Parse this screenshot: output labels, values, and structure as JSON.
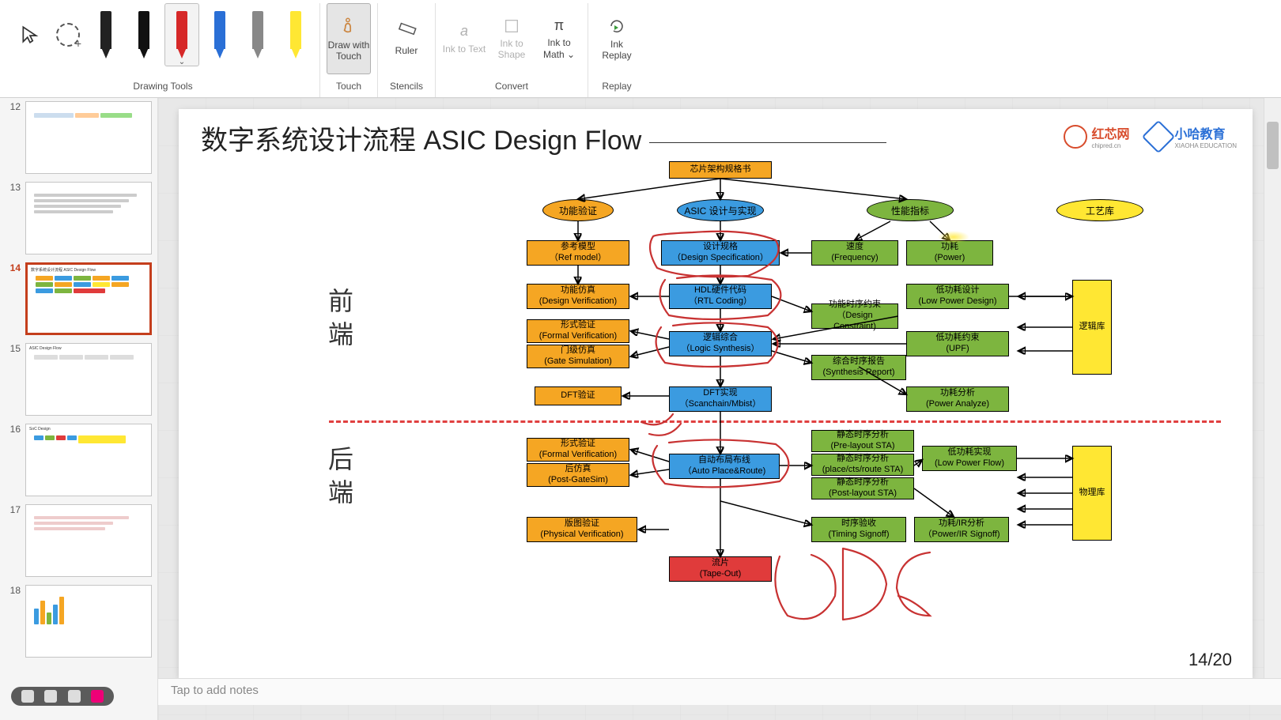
{
  "ribbon": {
    "groups": {
      "drawing": "Drawing Tools",
      "touch": "Touch",
      "stencils": "Stencils",
      "convert": "Convert",
      "replay": "Replay"
    },
    "tools": {
      "draw_touch": "Draw with Touch",
      "ruler": "Ruler",
      "ink_text": "Ink to Text",
      "ink_shape": "Ink to Shape",
      "ink_math": "Ink to Math ⌄",
      "ink_replay": "Ink Replay"
    }
  },
  "thumbs": [
    {
      "num": "12",
      "title": ""
    },
    {
      "num": "13",
      "title": ""
    },
    {
      "num": "14",
      "title": "数字系统设计流程 ASIC Design Flow"
    },
    {
      "num": "15",
      "title": "ASIC Design Flow"
    },
    {
      "num": "16",
      "title": "SoC Design"
    },
    {
      "num": "17",
      "title": ""
    },
    {
      "num": "18",
      "title": ""
    }
  ],
  "active_thumb": "14",
  "slide": {
    "title": "数字系统设计流程 ASIC Design Flow",
    "logo1": {
      "name": "红芯网",
      "sub": "chipred.cn",
      "color": "#d84c2c"
    },
    "logo2": {
      "name": "小哈教育",
      "sub": "XIAOHA EDUCATION",
      "color": "#2a6fd6"
    },
    "side_front": "前端",
    "side_back": "后端",
    "page": "14/20",
    "boxes": {
      "spec": "芯片架构规格书",
      "func_ver": "功能验证",
      "asic_des": "ASIC 设计与实现",
      "perf": "性能指标",
      "lib": "工艺库",
      "ref_model": "参考模型\n（Ref model）",
      "design_spec": "设计规格\n（Design Specification）",
      "freq": "速度\n(Frequency)",
      "power": "功耗\n(Power)",
      "design_ver": "功能仿真\n(Design Verification)",
      "rtl": "HDL硬件代码\n（RTL Coding）",
      "lowpower": "低功耗设计\n(Low Power Design)",
      "formal1": "形式验证\n(Formal Verification)",
      "constraint": "功能时序约束\n（Design Constraint)",
      "logic_lib": "逻辑库",
      "gate_sim": "门级仿真\n(Gate Simulation)",
      "synth": "逻辑综合\n（Logic Synthesis）",
      "upf": "低功耗约束\n(UPF)",
      "synth_rep": "综合时序报告\n(Synthesis Report)",
      "dft_ver": "DFT验证",
      "dft_impl": "DFT实现\n（Scanchain/Mbist）",
      "power_an": "功耗分析\n(Power Analyze)",
      "formal2": "形式验证\n(Formal Verification)",
      "pre_sta": "静态时序分析\n(Pre-layout STA)",
      "lowflow": "低功耗实现\n(Low Power Flow)",
      "post_gate": "后仿真\n(Post-GateSim)",
      "apr": "自动布局布线\n（Auto Place&Route)",
      "cts_sta": "静态时序分析\n(place/cts/route STA)",
      "phy_lib": "物理库",
      "post_sta": "静态时序分析\n(Post-layout STA)",
      "phys_ver": "版图验证\n(Physical Verification)",
      "timing_so": "时序验收\n(Timing Signoff)",
      "power_so": "功耗/IR分析\n（Power/IR Signoff)",
      "tapeout": "流片\n(Tape-Out)"
    }
  },
  "notes_placeholder": "Tap to add notes"
}
